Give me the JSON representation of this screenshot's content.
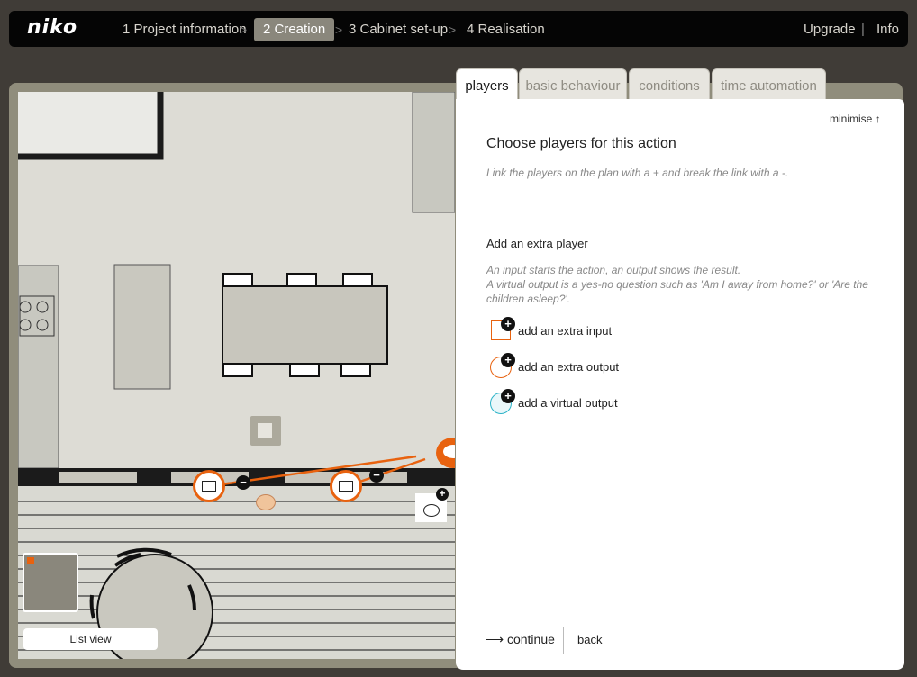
{
  "brand": {
    "logo": "niko"
  },
  "nav": {
    "steps": [
      {
        "label": "1 Project information",
        "active": false
      },
      {
        "label": "2 Creation",
        "active": true
      },
      {
        "label": "3 Cabinet set-up",
        "active": false
      },
      {
        "label": "4 Realisation",
        "active": false
      }
    ],
    "upgrade": "Upgrade",
    "info": "Info"
  },
  "tabs": [
    {
      "label": "players",
      "active": true
    },
    {
      "label": "basic behaviour",
      "active": false
    },
    {
      "label": "conditions",
      "active": false
    },
    {
      "label": "time automation",
      "active": false
    }
  ],
  "panel": {
    "minimise": "minimise",
    "heading": "Choose players for this action",
    "hint": "Link the players on the plan with a + and break the link with a -.",
    "extra_title": "Add an extra player",
    "extra_desc_1": "An input starts the action, an output shows the result.",
    "extra_desc_2": "A virtual output is a yes-no question such as 'Am I away from home?' or 'Are the children asleep?'.",
    "options": [
      {
        "label": "add an extra input",
        "icon": "input-square-icon"
      },
      {
        "label": "add an extra output",
        "icon": "output-circle-icon"
      },
      {
        "label": "add a virtual output",
        "icon": "virtual-output-icon"
      }
    ],
    "continue": "continue",
    "back": "back"
  },
  "plan": {
    "list_view": "List view"
  },
  "colors": {
    "accent": "#e8620f",
    "topbar": "#050505",
    "active_step": "#8a877c",
    "frame": "#908d7c",
    "floor": "#d9d9d2",
    "virtual": "#2bb3c8"
  }
}
